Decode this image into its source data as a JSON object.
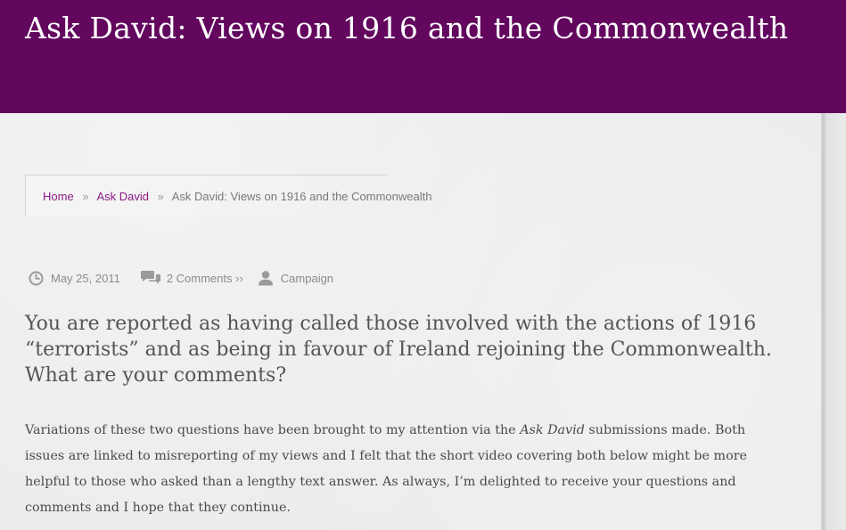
{
  "header": {
    "title": "Ask David: Views on 1916 and the Commonwealth"
  },
  "breadcrumb": {
    "items": [
      "Home",
      "Ask David"
    ],
    "separator": "»",
    "current": "Ask David: Views on 1916 and the Commonwealth"
  },
  "meta": {
    "date": "May 25, 2011",
    "comments": "2 Comments ››",
    "category": "Campaign"
  },
  "post": {
    "title": "You are reported as having called those involved with the actions of 1916 “terrorists” and as being in favour of Ireland rejoining the Commonwealth. What are your comments?",
    "body_before": "Variations of these two questions have been brought to my attention via the ",
    "body_emphasis": "Ask David",
    "body_after": " submissions made. Both issues are linked to misreporting of my views and I felt that the short video covering both below might be more helpful to those who asked than a lengthy text answer. As always, I’m delighted to receive your questions and comments and I hope that they continue."
  },
  "colors": {
    "header_bg": "#62065e",
    "link": "#8a1a85",
    "page_bg": "#e9e9e9"
  }
}
